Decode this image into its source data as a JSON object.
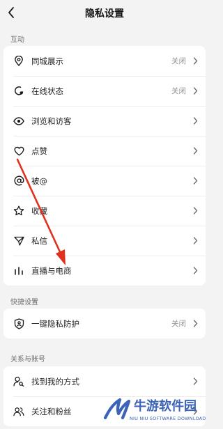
{
  "header": {
    "title": "隐私设置"
  },
  "sections": [
    {
      "label": "互动",
      "items": [
        {
          "label": "同城展示",
          "value": "关闭",
          "icon": "location-pin-icon"
        },
        {
          "label": "在线状态",
          "value": "关闭",
          "icon": "online-status-icon"
        },
        {
          "label": "浏览和访客",
          "value": "",
          "icon": "eye-icon"
        },
        {
          "label": "点赞",
          "value": "",
          "icon": "heart-icon"
        },
        {
          "label": "被@",
          "value": "",
          "icon": "at-icon"
        },
        {
          "label": "收藏",
          "value": "",
          "icon": "star-icon"
        },
        {
          "label": "私信",
          "value": "",
          "icon": "send-icon"
        },
        {
          "label": "直播与电商",
          "value": "",
          "icon": "bars-icon"
        }
      ]
    },
    {
      "label": "快捷设置",
      "items": [
        {
          "label": "一键隐私防护",
          "value": "关闭",
          "icon": "shield-icon"
        }
      ]
    },
    {
      "label": "关系与账号",
      "items": [
        {
          "label": "找到我的方式",
          "value": "",
          "icon": "user-search-icon"
        },
        {
          "label": "关注和粉丝",
          "value": "",
          "icon": "users-icon"
        }
      ]
    }
  ],
  "watermark": {
    "name": "牛游软件园",
    "sub": "NIU NIU SOFTWARE DOWNLOAD"
  },
  "annotation": {
    "color": "#e0301e"
  }
}
